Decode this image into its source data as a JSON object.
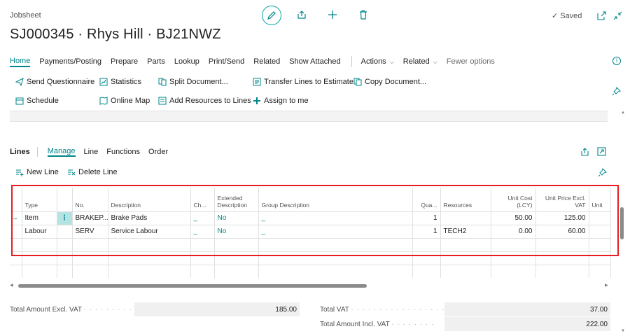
{
  "header": {
    "doc_kind": "Jobsheet",
    "title": "SJ000345 · Rhys Hill · BJ21NWZ",
    "saved_label": "Saved"
  },
  "menubar": {
    "home": "Home",
    "payments": "Payments/Posting",
    "prepare": "Prepare",
    "parts": "Parts",
    "lookup": "Lookup",
    "print_send": "Print/Send",
    "related": "Related",
    "show_attached": "Show Attached",
    "actions": "Actions",
    "related2": "Related",
    "fewer_options": "Fewer options"
  },
  "actions": {
    "send_questionnaire": "Send Questionnaire",
    "statistics": "Statistics",
    "split_document": "Split Document...",
    "transfer_lines": "Transfer Lines to Estimate",
    "copy_document": "Copy Document...",
    "schedule": "Schedule",
    "online_map": "Online Map",
    "add_resources": "Add Resources to Lines",
    "assign_to_me": "Assign to me"
  },
  "lines": {
    "title": "Lines",
    "tabs": [
      "Manage",
      "Line",
      "Functions",
      "Order"
    ],
    "new_line": "New Line",
    "delete_line": "Delete Line",
    "columns": {
      "type": "Type",
      "no": "No.",
      "description": "Description",
      "ch": "Ch...",
      "extended": "Extended Description",
      "group": "Group Description",
      "qty": "Qua...",
      "resources": "Resources",
      "unit_cost": "Unit Cost (LCY)",
      "unit_price": "Unit Price Excl. VAT",
      "unit": "Unit"
    },
    "rows": [
      {
        "type": "Item",
        "no": "BRAKEP...",
        "description": "Brake Pads",
        "ch": "_",
        "extended": "No",
        "group": "_",
        "qty": "1",
        "resources": "",
        "unit_cost": "50.00",
        "unit_price": "125.00"
      },
      {
        "type": "Labour",
        "no": "SERV",
        "description": "Service Labour",
        "ch": "_",
        "extended": "No",
        "group": "_",
        "qty": "1",
        "resources": "TECH2",
        "unit_cost": "0.00",
        "unit_price": "60.00"
      }
    ]
  },
  "totals": {
    "excl_label": "Total Amount Excl. VAT",
    "excl_value": "185.00",
    "vat_label": "Total VAT",
    "vat_value": "37.00",
    "incl_label": "Total Amount Incl. VAT",
    "incl_value": "222.00"
  },
  "colors": {
    "accent": "#00858a",
    "highlight_box": "#e81c24"
  }
}
